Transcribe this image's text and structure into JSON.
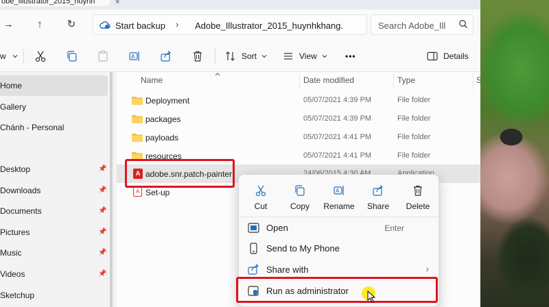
{
  "window": {
    "tab_title": "obe_Illustrator_2015_huynh",
    "tab_close": "×"
  },
  "address_bar": {
    "root": "Start backup",
    "folder": "Adobe_Illustrator_2015_huynhkhang.",
    "separator": "›"
  },
  "search": {
    "placeholder": "Search Adobe_Ill"
  },
  "command_bar": {
    "new_partial": "w",
    "sort_label": "Sort",
    "view_label": "View",
    "more_label": "•••",
    "details_label": "Details"
  },
  "sidebar": {
    "items": [
      {
        "label": "Home",
        "pinned": false,
        "active": true
      },
      {
        "label": "Gallery",
        "pinned": false,
        "active": false
      },
      {
        "label": "Chánh - Personal",
        "pinned": false,
        "active": false
      },
      {
        "label": "Desktop",
        "pinned": true,
        "active": false
      },
      {
        "label": "Downloads",
        "pinned": true,
        "active": false
      },
      {
        "label": "Documents",
        "pinned": true,
        "active": false
      },
      {
        "label": "Pictures",
        "pinned": true,
        "active": false
      },
      {
        "label": "Music",
        "pinned": true,
        "active": false
      },
      {
        "label": "Videos",
        "pinned": true,
        "active": false
      },
      {
        "label": "Sketchup",
        "pinned": false,
        "active": false
      }
    ]
  },
  "file_list": {
    "columns": {
      "name": "Name",
      "date": "Date modified",
      "type": "Type",
      "size": "S"
    },
    "rows": [
      {
        "name": "Deployment",
        "date": "05/07/2021 4:39 PM",
        "type": "File folder",
        "kind": "folder"
      },
      {
        "name": "packages",
        "date": "05/07/2021 4:39 PM",
        "type": "File folder",
        "kind": "folder"
      },
      {
        "name": "payloads",
        "date": "05/07/2021 4:41 PM",
        "type": "File folder",
        "kind": "folder"
      },
      {
        "name": "resources",
        "date": "05/07/2021 4:41 PM",
        "type": "File folder",
        "kind": "folder"
      },
      {
        "name": "adobe.snr.patch-painter",
        "date": "24/06/2015 4:30 AM",
        "type": "Application",
        "kind": "app"
      },
      {
        "name": "Set-up",
        "date": "",
        "type": "",
        "kind": "setup"
      }
    ]
  },
  "context_menu": {
    "quick_actions": [
      {
        "label": "Cut",
        "icon": "scissors-icon"
      },
      {
        "label": "Copy",
        "icon": "copy-icon"
      },
      {
        "label": "Rename",
        "icon": "rename-icon"
      },
      {
        "label": "Share",
        "icon": "share-icon"
      },
      {
        "label": "Delete",
        "icon": "trash-icon"
      }
    ],
    "items": [
      {
        "label": "Open",
        "shortcut": "Enter",
        "icon": "open-app-icon",
        "submenu": false
      },
      {
        "label": "Send to My Phone",
        "shortcut": "",
        "icon": "phone-icon",
        "submenu": false
      },
      {
        "label": "Share with",
        "shortcut": "",
        "icon": "share-with-icon",
        "submenu": true
      },
      {
        "label": "Run as administrator",
        "shortcut": "",
        "icon": "shield-icon",
        "submenu": false
      }
    ],
    "submenu_arrow": "›"
  },
  "colors": {
    "highlight_box": "#e0141e",
    "accent": "#0067c0",
    "cursor_halo": "#ffe800"
  }
}
